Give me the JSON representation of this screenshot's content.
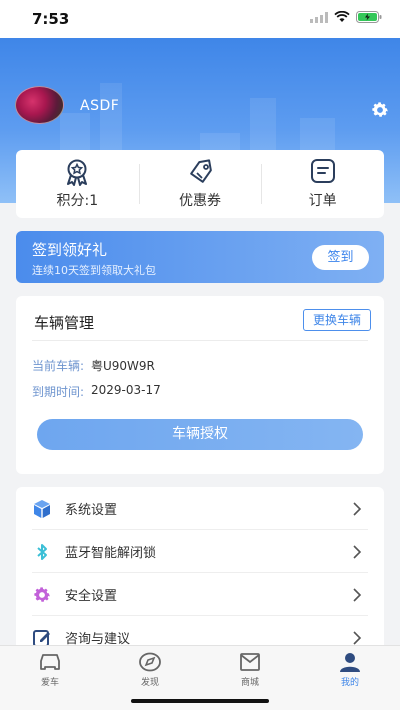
{
  "status_bar": {
    "time": "7:53"
  },
  "user": {
    "name": "ASDF",
    "avatar_icon": "avatar-photo",
    "settings_icon": "gear-icon"
  },
  "stats": [
    {
      "label": "积分:1",
      "icon": "medal-icon"
    },
    {
      "label": "优惠券",
      "icon": "coupon-tag-icon"
    },
    {
      "label": "订单",
      "icon": "order-icon"
    }
  ],
  "checkin": {
    "title": "签到领好礼",
    "subtitle": "连续10天签到领取大礼包",
    "button": "签到"
  },
  "vehicle": {
    "title": "车辆管理",
    "change_button": "更换车辆",
    "current_label": "当前车辆:",
    "current_value": "粤U90W9R",
    "expire_label": "到期时间:",
    "expire_value": "2029-03-17",
    "auth_button": "车辆授权"
  },
  "menu": [
    {
      "label": "系统设置",
      "icon": "cube-icon",
      "color": "#3f86e8"
    },
    {
      "label": "蓝牙智能解闭锁",
      "icon": "bluetooth-icon",
      "color": "#3bbfd6"
    },
    {
      "label": "安全设置",
      "icon": "gear-icon",
      "color": "#c261d9"
    },
    {
      "label": "咨询与建议",
      "icon": "edit-icon",
      "color": "#2f4c80"
    }
  ],
  "tabs": [
    {
      "label": "爱车",
      "icon": "car-icon",
      "active": false
    },
    {
      "label": "发现",
      "icon": "compass-icon",
      "active": false
    },
    {
      "label": "商城",
      "icon": "mail-icon",
      "active": false
    },
    {
      "label": "我的",
      "icon": "person-icon",
      "active": true
    }
  ],
  "colors": {
    "primary": "#3f86e8",
    "background": "#f2f3f5"
  }
}
